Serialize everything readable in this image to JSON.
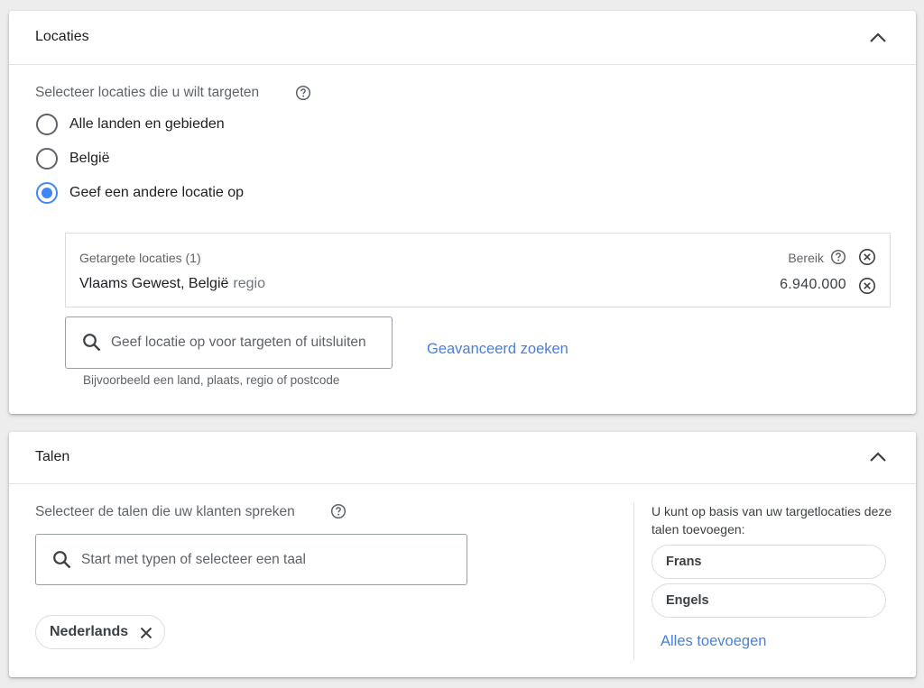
{
  "locations": {
    "title": "Locaties",
    "prompt": "Selecteer locaties die u wilt targeten",
    "options": [
      {
        "label": "Alle landen en gebieden",
        "checked": false
      },
      {
        "label": "België",
        "checked": false
      },
      {
        "label": "Geef een andere locatie op",
        "checked": true
      }
    ],
    "targeted": {
      "header": "Getargete locaties (1)",
      "reach_label": "Bereik",
      "items": [
        {
          "name": "Vlaams Gewest, België",
          "type": "regio",
          "reach": "6.940.000"
        }
      ]
    },
    "search": {
      "placeholder": "Geef locatie op voor targeten of uitsluiten",
      "hint": "Bijvoorbeeld een land, plaats, regio of postcode"
    },
    "advanced_link": "Geavanceerd zoeken"
  },
  "languages": {
    "title": "Talen",
    "prompt": "Selecteer de talen die uw klanten spreken",
    "search": {
      "placeholder": "Start met typen of selecteer een taal"
    },
    "selected": [
      {
        "label": "Nederlands"
      }
    ],
    "suggestions": {
      "text": "U kunt op basis van uw targetlocaties deze talen toevoegen:",
      "items": [
        {
          "label": "Frans"
        },
        {
          "label": "Engels"
        }
      ],
      "add_all": "Alles toevoegen"
    }
  },
  "colors": {
    "accent": "#4285f4",
    "link": "#4a7fd8",
    "text": "#202124",
    "muted": "#5f6368",
    "border": "#dadce0"
  },
  "icons": {
    "collapse": "chevron-up-icon",
    "help": "help-circle-icon",
    "remove": "close-circle-icon",
    "search": "search-icon",
    "chip_remove": "close-icon"
  }
}
